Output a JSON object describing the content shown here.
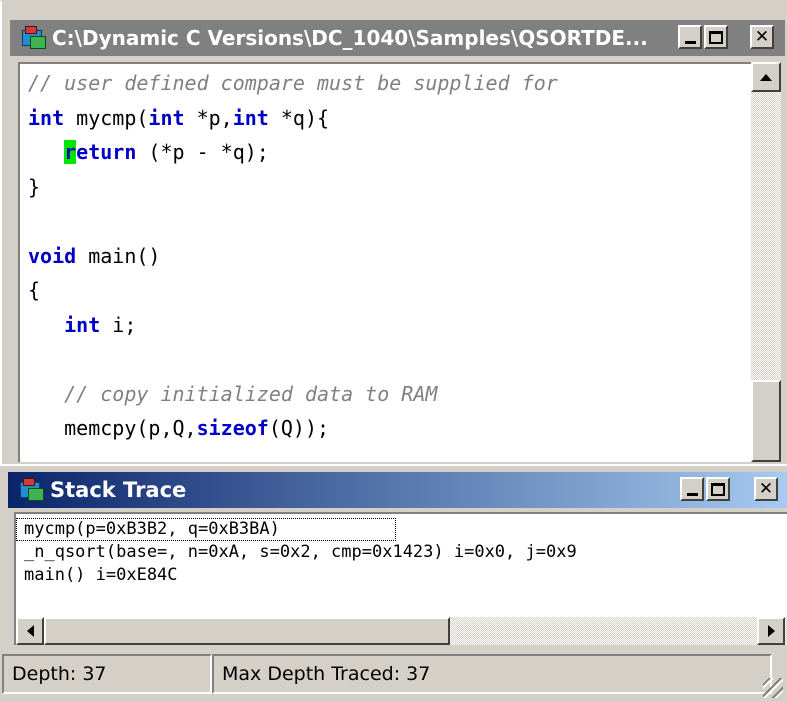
{
  "editor": {
    "title": "C:\\Dynamic C Versions\\DC_1040\\Samples\\QSORTDE...",
    "code_lines": [
      [
        {
          "t": "// user defined compare must be supplied for",
          "c": "cm"
        }
      ],
      [
        {
          "t": "int",
          "c": "kw"
        },
        {
          "t": " mycmp("
        },
        {
          "t": "int",
          "c": "kw"
        },
        {
          "t": " *p,"
        },
        {
          "t": "int",
          "c": "kw"
        },
        {
          "t": " *q){"
        }
      ],
      [
        {
          "t": "   "
        },
        {
          "t": "r",
          "c": "kw cursor"
        },
        {
          "t": "eturn",
          "c": "kw"
        },
        {
          "t": " (*p - *q);"
        }
      ],
      [
        {
          "t": "}"
        }
      ],
      [
        {
          "t": ""
        }
      ],
      [
        {
          "t": "void",
          "c": "kw"
        },
        {
          "t": " main()"
        }
      ],
      [
        {
          "t": "{"
        }
      ],
      [
        {
          "t": "   "
        },
        {
          "t": "int",
          "c": "kw"
        },
        {
          "t": " i;"
        }
      ],
      [
        {
          "t": ""
        }
      ],
      [
        {
          "t": "   "
        },
        {
          "t": "// copy initialized data to RAM",
          "c": "cm"
        }
      ],
      [
        {
          "t": "   memcpy(p,Q,"
        },
        {
          "t": "sizeof",
          "c": "kw"
        },
        {
          "t": "(Q));"
        }
      ]
    ]
  },
  "stack_trace": {
    "title": "Stack Trace",
    "rows": [
      "mycmp(p=0xB3B2, q=0xB3BA)",
      "_n_qsort(base=, n=0xA, s=0x2, cmp=0x1423) i=0x0, j=0x9",
      "main() i=0xE84C"
    ]
  },
  "status": {
    "depth": "Depth: 37",
    "max_depth": "Max Depth Traced: 37"
  },
  "window_buttons": {
    "minimize": "_",
    "close": "✕"
  },
  "colors": {
    "keyword": "#0000c8",
    "comment": "#808080",
    "cursor": "#00e600",
    "active_title_start": "#0a246a",
    "active_title_end": "#a6caf0",
    "inactive_title": "#808080"
  },
  "icons": [
    "dynamic-c-app-icon",
    "minimize-icon",
    "maximize-icon",
    "close-icon",
    "scroll-up-arrow-icon",
    "scroll-left-arrow-icon",
    "scroll-right-arrow-icon",
    "resize-grip-icon"
  ]
}
